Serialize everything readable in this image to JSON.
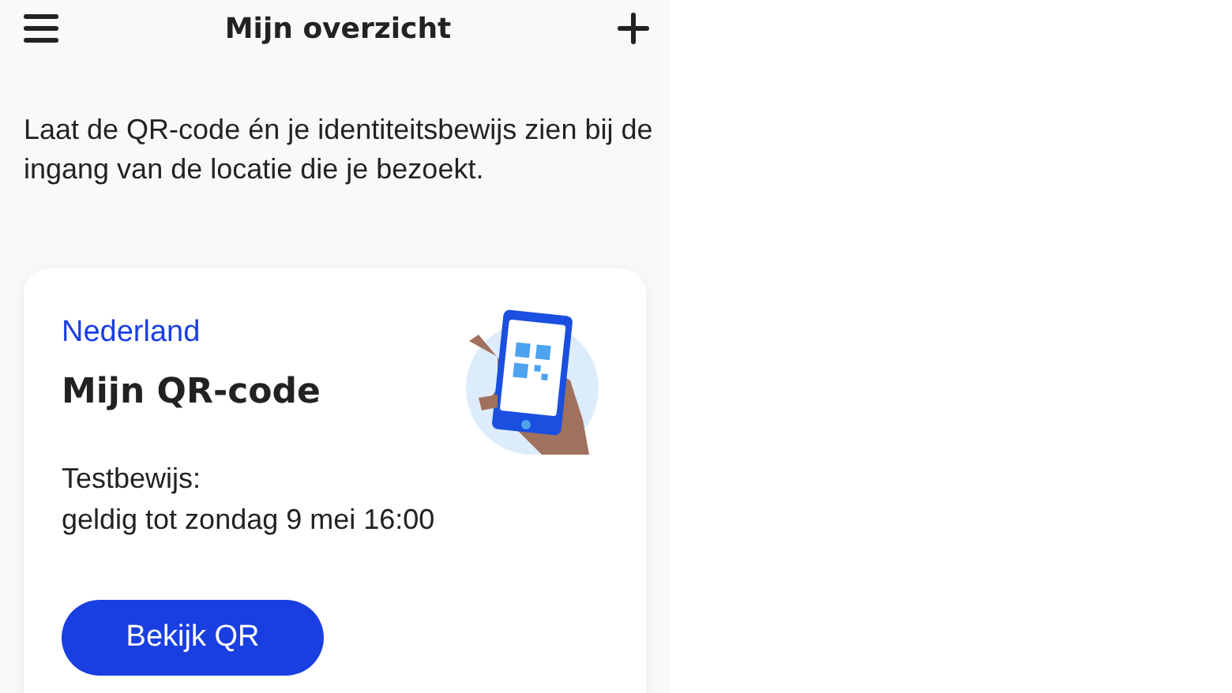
{
  "header": {
    "title": "Mijn overzicht"
  },
  "intro": "Laat de QR-code én je identiteitsbewijs zien bij de ingang van de locatie die je bezoekt.",
  "card": {
    "country": "Nederland",
    "title": "Mijn QR-code",
    "lines": [
      "Testbewijs:",
      "geldig tot zondag 9 mei 16:00"
    ],
    "button": "Bekijk QR"
  }
}
